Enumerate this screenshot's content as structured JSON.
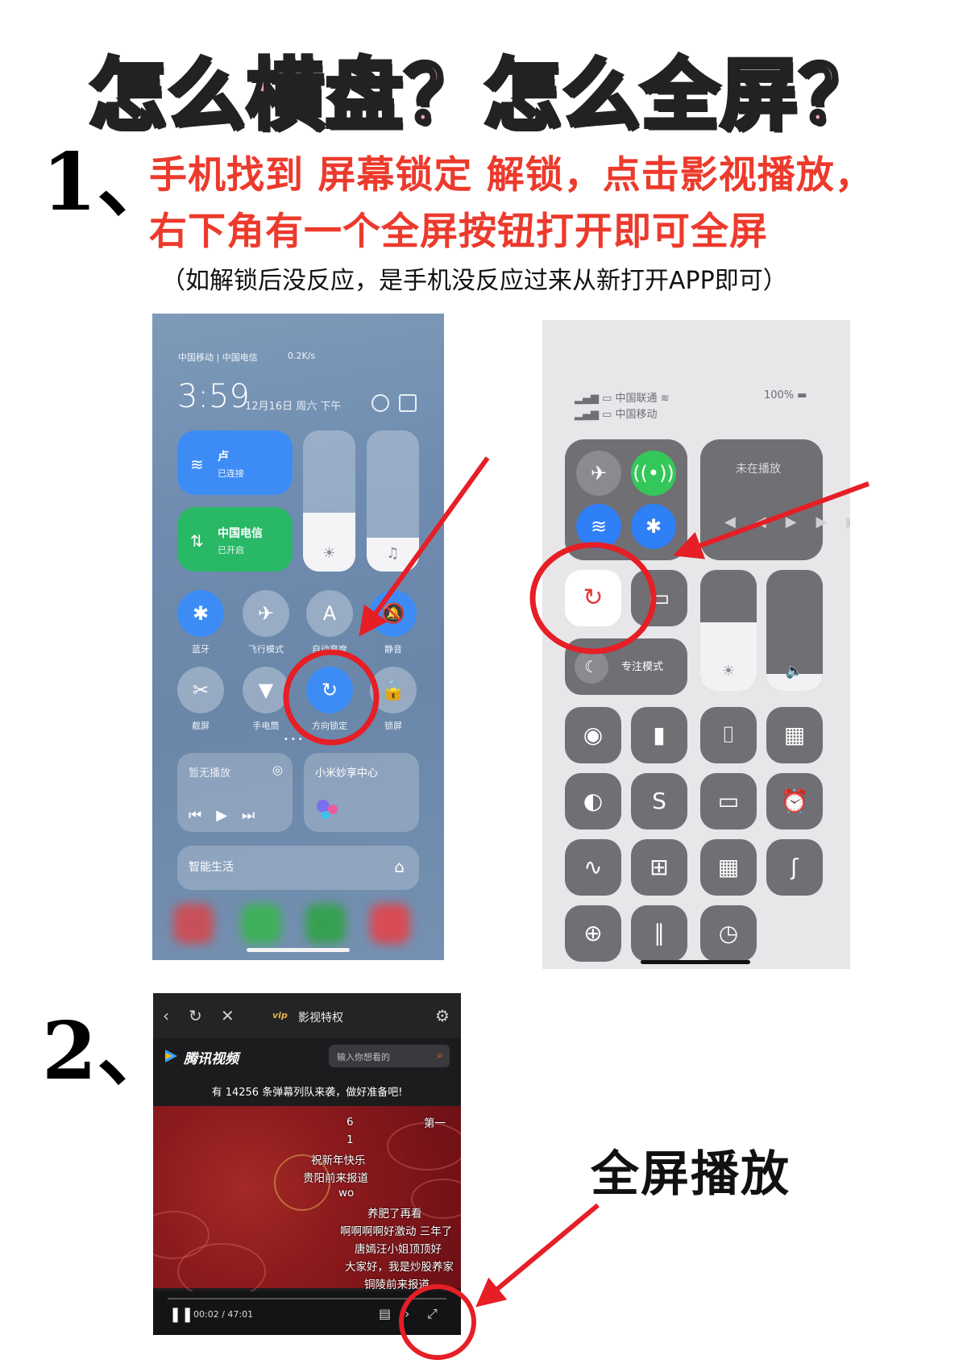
{
  "title": "怎么横盘？怎么全屏？",
  "step1": {
    "number": "1、",
    "line1": "手机找到 屏幕锁定 解锁，点击影视播放，",
    "line2": "右下角有一个全屏按钮打开即可全屏",
    "note": "（如解锁后没反应，是手机没反应过来从新打开APP即可）"
  },
  "step2": {
    "number": "2、",
    "fullscreen_label": "全屏播放"
  },
  "xiaomi": {
    "status_left": "中国移动 | 中国电信",
    "status_right": "0.2K/s",
    "time": "3:59",
    "date": "12月16日 周六 下午",
    "wifi_title": "卢",
    "wifi_sub": "已连接",
    "cell_title": "中国电信",
    "cell_sub": "已开启",
    "row1": [
      {
        "label": "蓝牙",
        "icon": "bluetooth-icon"
      },
      {
        "label": "飞行模式",
        "icon": "airplane-icon"
      },
      {
        "label": "自动亮度",
        "icon": "auto-brightness-icon"
      },
      {
        "label": "静音",
        "icon": "mute-icon"
      }
    ],
    "row2": [
      {
        "label": "截屏",
        "icon": "screenshot-icon"
      },
      {
        "label": "手电筒",
        "icon": "flashlight-icon"
      },
      {
        "label": "方向锁定",
        "icon": "rotation-lock-icon"
      },
      {
        "label": "锁屏",
        "icon": "lock-icon"
      }
    ],
    "media_label": "暂无播放",
    "share_label": "小米妙享中心",
    "life_label": "智能生活"
  },
  "iphone": {
    "carrier1": "中国联通",
    "carrier2": "中国移动",
    "battery": "100%",
    "now_playing": "未在播放",
    "focus_label": "专注模式"
  },
  "tencent": {
    "vip_badge": "vip",
    "vip_title": "影视特权",
    "brand": "腾讯视频",
    "search_placeholder": "输入你想看的",
    "danmu_count": "有 14256 条弹幕列队来袭，做好准备吧!",
    "danmaku": [
      "6",
      "1",
      "祝新年快乐",
      "贵阳前来报道",
      "wo",
      "养肥了再看",
      "啊啊啊啊好激动 三年了",
      "唐嫣汪小姐顶顶好",
      "大家好，我是炒股养家",
      "铜陵前来报道",
      "第一"
    ],
    "playback_time": "00:02 / 47:01"
  },
  "colors": {
    "title_pink": "#f8a2cf",
    "instruction_red": "#ec3a2c",
    "annotation_red": "#e61e25",
    "xiaomi_blue": "#3d8cf6",
    "xiaomi_green": "#28b866"
  }
}
